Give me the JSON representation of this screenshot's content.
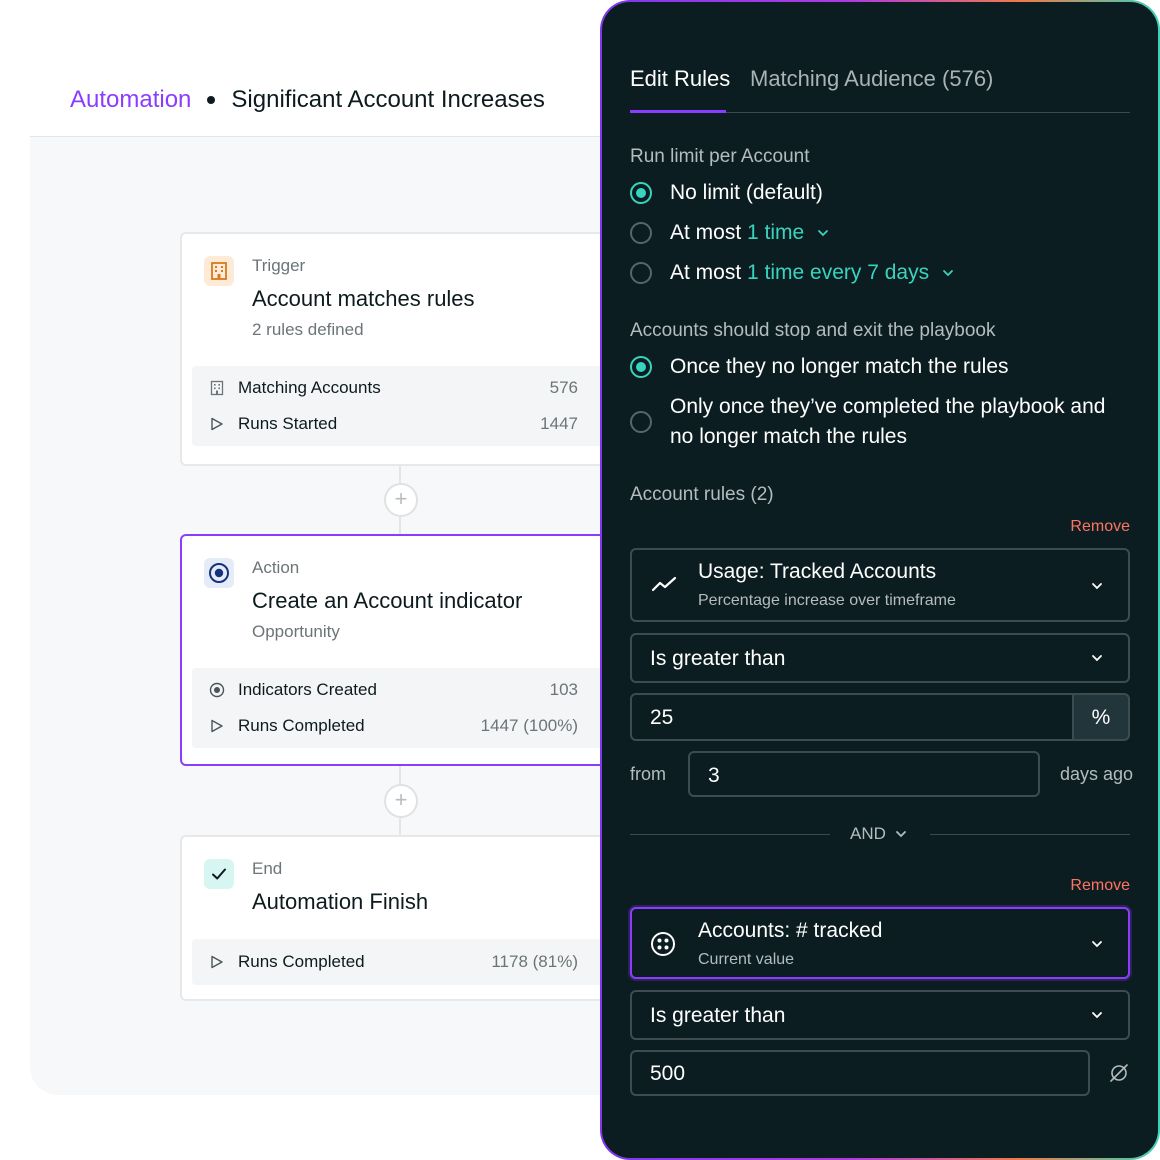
{
  "breadcrumb": {
    "root": "Automation",
    "current": "Significant Account Increases"
  },
  "cards": {
    "trigger": {
      "kind": "Trigger",
      "title": "Account matches rules",
      "subtitle": "2 rules defined",
      "icon": "building-icon",
      "stats": [
        {
          "label": "Matching Accounts",
          "value": "576",
          "icon": "building-icon"
        },
        {
          "label": "Runs Started",
          "value": "1447",
          "icon": "play-icon"
        }
      ]
    },
    "action": {
      "kind": "Action",
      "title": "Create an Account indicator",
      "subtitle": "Opportunity",
      "icon": "target-icon",
      "stats": [
        {
          "label": "Indicators Created",
          "value": "103",
          "icon": "target-icon"
        },
        {
          "label": "Runs Completed",
          "value": "1447 (100%)",
          "icon": "play-icon"
        }
      ]
    },
    "end": {
      "kind": "End",
      "title": "Automation Finish",
      "icon": "check-icon",
      "stats": [
        {
          "label": "Runs Completed",
          "value": "1178 (81%)",
          "icon": "play-icon"
        }
      ]
    }
  },
  "add_step_symbol": "+",
  "panel": {
    "tabs": [
      {
        "label": "Edit Rules",
        "active": true
      },
      {
        "label": "Matching Audience (576)",
        "active": false
      }
    ],
    "run_limit": {
      "label": "Run limit per Account",
      "options": [
        {
          "text": "No limit (default)",
          "selected": true
        },
        {
          "prefix": "At most ",
          "highlight": "1 time",
          "selected": false
        },
        {
          "prefix": "At most ",
          "highlight": "1 time every 7 days",
          "selected": false
        }
      ]
    },
    "exit": {
      "label": "Accounts should stop and exit the playbook",
      "options": [
        {
          "text": "Once they no longer match the rules",
          "selected": true
        },
        {
          "line1": "Only once they’ve completed the playbook and",
          "line2": "no longer match the rules",
          "selected": false
        }
      ]
    },
    "rules_label": "Account rules (2)",
    "remove_label": "Remove",
    "rule1": {
      "metric_title": "Usage: Tracked Accounts",
      "metric_sub": "Percentage increase over timeframe",
      "metric_icon": "trend-line-icon",
      "operator": "Is greater than",
      "value": "25",
      "unit": "%",
      "from_label": "from",
      "days_value": "3",
      "days_suffix": "days ago"
    },
    "and_label": "AND",
    "rule2": {
      "metric_title": "Accounts: # tracked",
      "metric_sub": "Current value",
      "metric_icon": "dots-circle-icon",
      "operator": "Is greater than",
      "value": "500",
      "clear_icon": "empty-set-icon"
    }
  },
  "colors": {
    "accent": "#8b3dff",
    "teal": "#38d4bd",
    "remove": "#ff7461",
    "panel_bg": "#0c1d21"
  }
}
